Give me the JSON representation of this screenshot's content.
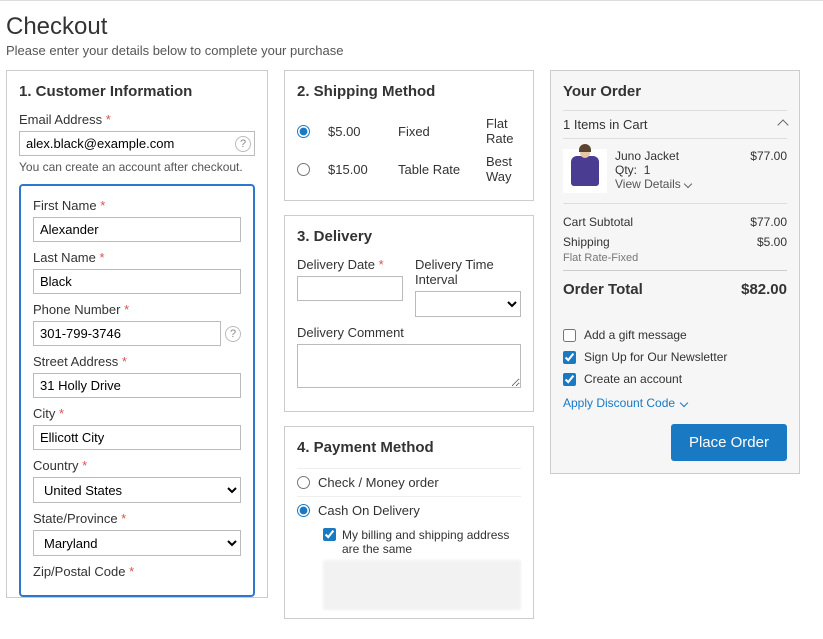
{
  "header": {
    "title": "Checkout",
    "subtitle": "Please enter your details below to complete your purchase"
  },
  "customer": {
    "section_title": "1. Customer Information",
    "email_label": "Email Address",
    "email_value": "alex.black@example.com",
    "email_note": "You can create an account after checkout.",
    "first_name_label": "First Name",
    "first_name_value": "Alexander",
    "last_name_label": "Last Name",
    "last_name_value": "Black",
    "phone_label": "Phone Number",
    "phone_value": "301-799-3746",
    "street_label": "Street Address",
    "street_value": "31 Holly Drive",
    "city_label": "City",
    "city_value": "Ellicott City",
    "country_label": "Country",
    "country_value": "United States",
    "state_label": "State/Province",
    "state_value": "Maryland",
    "zip_label": "Zip/Postal Code"
  },
  "shipping": {
    "section_title": "2. Shipping Method",
    "options": [
      {
        "price": "$5.00",
        "rate": "Fixed",
        "method": "Flat Rate",
        "selected": true
      },
      {
        "price": "$15.00",
        "rate": "Table Rate",
        "method": "Best Way",
        "selected": false
      }
    ]
  },
  "delivery": {
    "section_title": "3. Delivery",
    "date_label": "Delivery Date",
    "interval_label": "Delivery Time Interval",
    "comment_label": "Delivery Comment"
  },
  "payment": {
    "section_title": "4. Payment Method",
    "options": [
      {
        "label": "Check / Money order",
        "selected": false
      },
      {
        "label": "Cash On Delivery",
        "selected": true
      }
    ],
    "billing_same_label": "My billing and shipping address are the same",
    "billing_same_checked": true
  },
  "order": {
    "title": "Your Order",
    "items_header": "1 Items in Cart",
    "item": {
      "name": "Juno Jacket",
      "qty_label": "Qty:",
      "qty_value": "1",
      "price": "$77.00",
      "view_details": "View Details"
    },
    "subtotal_label": "Cart Subtotal",
    "subtotal_value": "$77.00",
    "shipping_label": "Shipping",
    "shipping_value": "$5.00",
    "shipping_sub": "Flat Rate-Fixed",
    "total_label": "Order Total",
    "total_value": "$82.00",
    "gift_label": "Add a gift message",
    "newsletter_label": "Sign Up for Our Newsletter",
    "create_account_label": "Create an account",
    "discount_label": "Apply Discount Code",
    "place_order_label": "Place Order"
  }
}
